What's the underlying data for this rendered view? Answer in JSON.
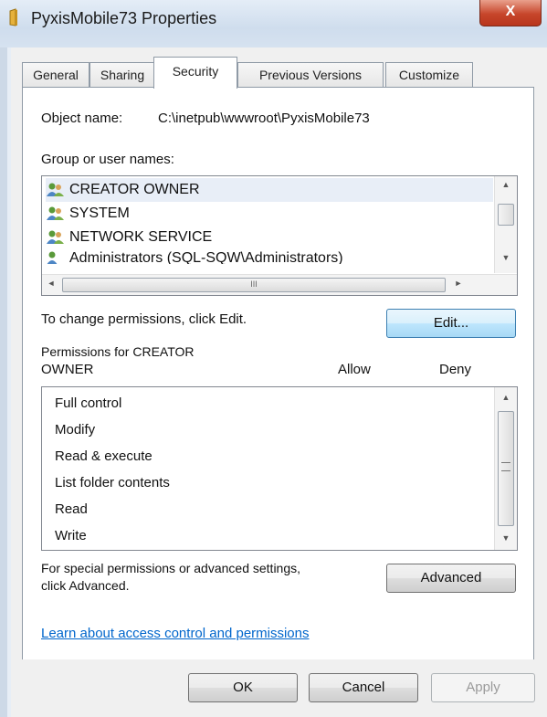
{
  "window": {
    "title": "PyxisMobile73 Properties",
    "close_label": "X"
  },
  "tabs": [
    "General",
    "Sharing",
    "Security",
    "Previous Versions",
    "Customize"
  ],
  "active_tab": "Security",
  "object": {
    "label": "Object name:",
    "value": "C:\\inetpub\\wwwroot\\PyxisMobile73"
  },
  "groups": {
    "label": "Group or user names:",
    "items": [
      "CREATOR OWNER",
      "SYSTEM",
      "NETWORK SERVICE",
      "Administrators (SQL-SQW\\Administrators)"
    ],
    "hscroll_grip": "III"
  },
  "change": {
    "text": "To change permissions, click Edit.",
    "edit_button": "Edit..."
  },
  "permissions": {
    "label_line1": "Permissions for CREATOR",
    "label_line2": "OWNER",
    "allow_header": "Allow",
    "deny_header": "Deny",
    "items": [
      "Full control",
      "Modify",
      "Read & execute",
      "List folder contents",
      "Read",
      "Write"
    ]
  },
  "special": {
    "line1": "For special permissions or advanced settings,",
    "line2": "click Advanced.",
    "advanced_button": "Advanced"
  },
  "link_text": "Learn about access control and permissions",
  "buttons": {
    "ok": "OK",
    "cancel": "Cancel",
    "apply": "Apply"
  },
  "colors": {
    "link": "#0066cc",
    "close": "#c7462b",
    "accent": "#3c7fb1"
  }
}
